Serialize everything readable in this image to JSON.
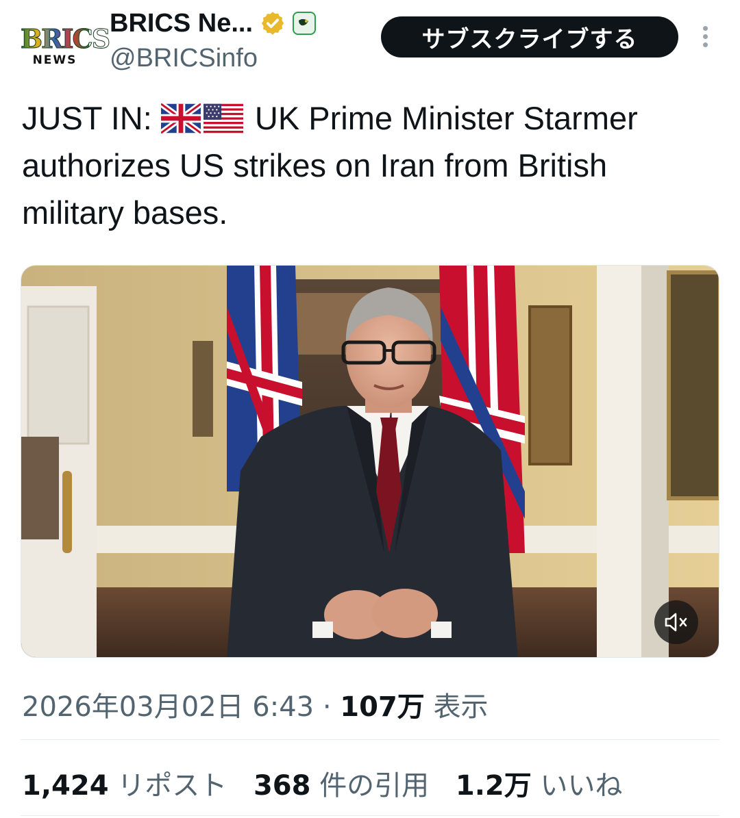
{
  "header": {
    "avatar_top": "BRICS",
    "avatar_bottom": "NEWS",
    "display_name": "BRICS Ne...",
    "handle": "@BRICSinfo",
    "subscribe_label": "サブスクライブする",
    "icons": [
      "verified-gold-badge-icon",
      "affiliate-badge-icon",
      "more-vertical-icon"
    ],
    "badge_color": "#e7b92b"
  },
  "tweet": {
    "prefix": "JUST IN:",
    "flags": [
      "uk-flag-icon",
      "us-flag-icon"
    ],
    "body": "UK Prime Minister Starmer authorizes US strikes on Iran from British military bases."
  },
  "media": {
    "type": "video",
    "icon": "volume-muted-icon"
  },
  "meta": {
    "date": "2026年03月02日 6:43",
    "separator": "·",
    "views_count": "107万",
    "views_label": "表示"
  },
  "stats": {
    "reposts_count": "1,424",
    "reposts_label": "リポスト",
    "quotes_count": "368",
    "quotes_label": "件の引用",
    "likes_count": "1.2万",
    "likes_label": "いいね"
  }
}
